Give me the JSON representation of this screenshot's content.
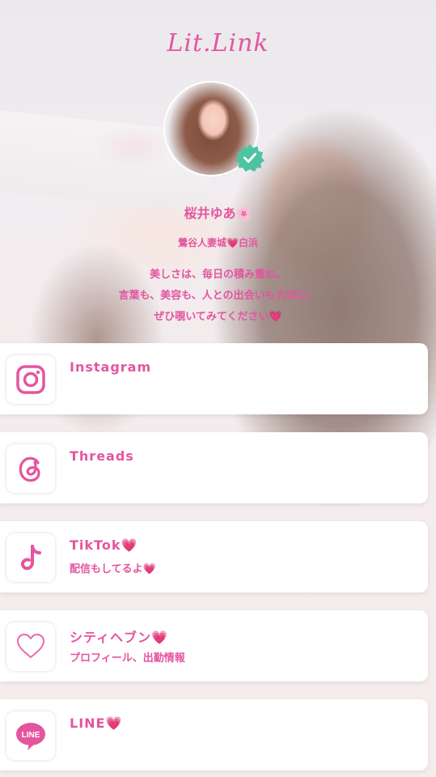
{
  "logo": "Lit.Link",
  "profile": {
    "name": "桜井ゆあ🌸",
    "subtitle": "鶯谷人妻城💗白浜",
    "bio_lines": [
      "美しさは、毎日の積み重ね。",
      "言葉も、美容も、人との出会いも大切に。",
      "ぜひ覗いてみてください💗"
    ]
  },
  "links": [
    {
      "title": "Instagram",
      "subtitle": "",
      "icon": "instagram-icon"
    },
    {
      "title": "Threads",
      "subtitle": "",
      "icon": "threads-icon"
    },
    {
      "title": "TikTok💗",
      "subtitle": "配信もしてるよ💗",
      "icon": "tiktok-icon"
    },
    {
      "title": "シティヘブン💗",
      "subtitle": "プロフィール、出勤情報",
      "icon": "heart-outline-icon"
    },
    {
      "title": "LINE💗",
      "subtitle": "",
      "icon": "line-icon"
    }
  ],
  "colors": {
    "accent": "#e4559f",
    "badge": "#4fc3a1",
    "line_bg": "#e4559f"
  }
}
